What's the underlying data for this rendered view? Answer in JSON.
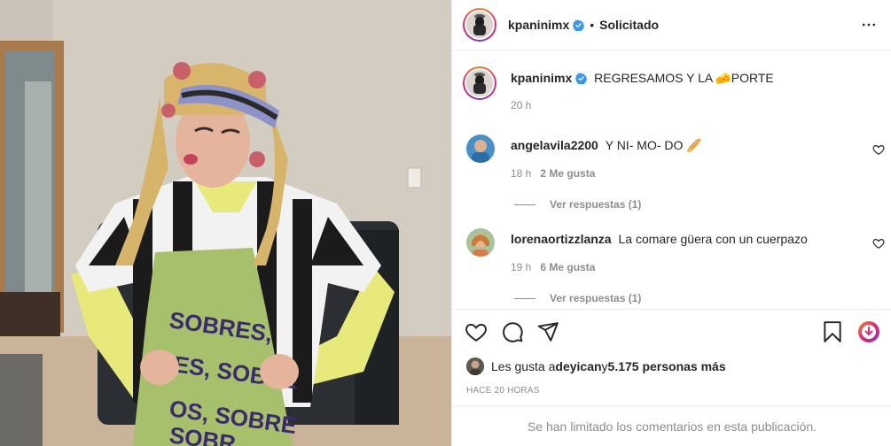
{
  "post": {
    "username": "kpaninimx",
    "follow_state": "Solicitado",
    "dot": "•",
    "more_icon": "more-horizontal-icon"
  },
  "caption": {
    "username": "kpaninimx",
    "text_before": "REGRESAMOS Y LA ",
    "emoji": "🧀",
    "text_after": "PORTE",
    "time": "20 h"
  },
  "comments": [
    {
      "username": "angelavila2200",
      "text": "Y NI- MO- DO ",
      "emoji": "🥖",
      "time": "18 h",
      "likes": "2 Me gusta",
      "replies": "Ver respuestas (1)"
    },
    {
      "username": "lorenaortizzlanza",
      "text": "La comare güera con un cuerpazo",
      "time": "19 h",
      "likes": "6 Me gusta",
      "replies": "Ver respuestas (1)"
    }
  ],
  "likes": {
    "prefix": "Les gusta a ",
    "user": "deyican",
    "middle": " y ",
    "count": "5.175 personas más"
  },
  "timestamp": "HACE 20 HORAS",
  "comments_limited": "Se han limitado los comentarios en esta publicación.",
  "colors": {
    "verified": "#3897f0",
    "muted": "#8e8e8e",
    "text": "#262626",
    "border": "#efefef"
  }
}
